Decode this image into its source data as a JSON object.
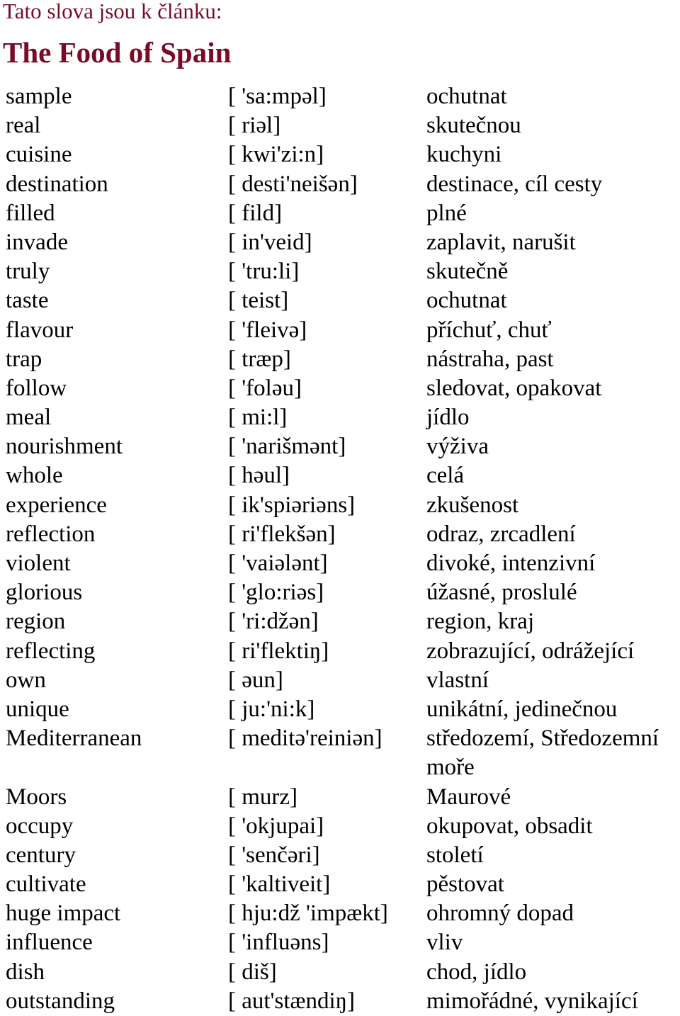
{
  "header": {
    "subtitle": "Tato slova jsou k článku:",
    "title": "The Food of Spain",
    "accent_color": "#7a0a26"
  },
  "vocabulary": [
    {
      "word": "sample",
      "pronunciation": "[ 'sa:mpəl]",
      "translation": "ochutnat"
    },
    {
      "word": "real",
      "pronunciation": "[ riəl]",
      "translation": "skutečnou"
    },
    {
      "word": "cuisine",
      "pronunciation": "[ kwi'zi:n]",
      "translation": "kuchyni"
    },
    {
      "word": "destination",
      "pronunciation": "[ desti'neišən]",
      "translation": "destinace, cíl cesty"
    },
    {
      "word": "filled",
      "pronunciation": "[ fild]",
      "translation": "plné"
    },
    {
      "word": "invade",
      "pronunciation": "[ in'veid]",
      "translation": "zaplavit, narušit"
    },
    {
      "word": "truly",
      "pronunciation": "[ 'tru:li]",
      "translation": "skutečně"
    },
    {
      "word": "taste",
      "pronunciation": "[ teist]",
      "translation": "ochutnat"
    },
    {
      "word": "flavour",
      "pronunciation": "[ 'fleivə]",
      "translation": "příchuť, chuť"
    },
    {
      "word": "trap",
      "pronunciation": "[ træp]",
      "translation": "nástraha, past"
    },
    {
      "word": "follow",
      "pronunciation": "[ 'foləu]",
      "translation": "sledovat, opakovat"
    },
    {
      "word": "meal",
      "pronunciation": "[ mi:l]",
      "translation": "jídlo"
    },
    {
      "word": "nourishment",
      "pronunciation": "[ 'narišmənt]",
      "translation": "výživa"
    },
    {
      "word": "whole",
      "pronunciation": "[ həul]",
      "translation": "celá"
    },
    {
      "word": "experience",
      "pronunciation": "[ ik'spiəriəns]",
      "translation": "zkušenost"
    },
    {
      "word": "reflection",
      "pronunciation": "[ ri'flekšən]",
      "translation": "odraz, zrcadlení"
    },
    {
      "word": "violent",
      "pronunciation": "[ 'vaiələnt]",
      "translation": "divoké, intenzivní"
    },
    {
      "word": "glorious",
      "pronunciation": "[ 'glo:riəs]",
      "translation": "úžasné, proslulé"
    },
    {
      "word": "region",
      "pronunciation": "[ 'ri:džən]",
      "translation": "region, kraj"
    },
    {
      "word": "reflecting",
      "pronunciation": "[ ri'flektiŋ]",
      "translation": "zobrazující, odrážející"
    },
    {
      "word": "own",
      "pronunciation": "[ əun]",
      "translation": "vlastní"
    },
    {
      "word": "unique",
      "pronunciation": "[ ju:'ni:k]",
      "translation": "unikátní, jedinečnou"
    },
    {
      "word": "Mediterranean",
      "pronunciation": "[ meditə'reiniən]",
      "translation": "středozemí, Středozemní moře"
    },
    {
      "word": "Moors",
      "pronunciation": "[ murz]",
      "translation": "Maurové"
    },
    {
      "word": "occupy",
      "pronunciation": "[ 'okjupai]",
      "translation": "okupovat, obsadit"
    },
    {
      "word": "century",
      "pronunciation": "[ 'senčəri]",
      "translation": "století"
    },
    {
      "word": "cultivate",
      "pronunciation": "[ 'kaltiveit]",
      "translation": "pěstovat"
    },
    {
      "word": "huge impact",
      "pronunciation": "[ hju:dž 'impækt]",
      "translation": "ohromný dopad"
    },
    {
      "word": "influence",
      "pronunciation": "[ 'influəns]",
      "translation": "vliv"
    },
    {
      "word": "dish",
      "pronunciation": "[ diš]",
      "translation": "chod, jídlo"
    },
    {
      "word": "outstanding",
      "pronunciation": "[ aut'stændiŋ]",
      "translation": "mimořádné, vynikající"
    }
  ]
}
